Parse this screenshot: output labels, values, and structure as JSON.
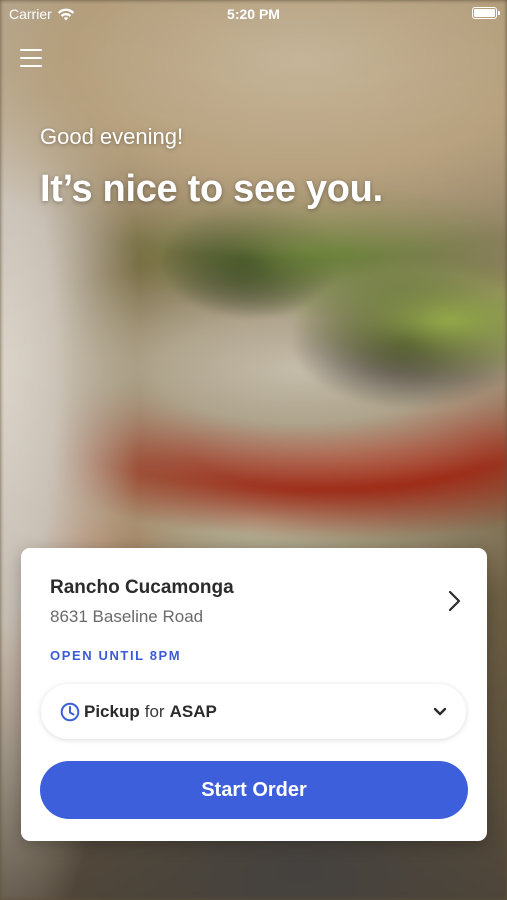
{
  "status_bar": {
    "carrier": "Carrier",
    "time": "5:20 PM",
    "icons": [
      "wifi-icon",
      "battery-icon"
    ]
  },
  "header": {
    "menu_icon": "hamburger-menu-icon"
  },
  "greeting": {
    "salutation": "Good evening!",
    "message": "It’s nice to see you."
  },
  "location_card": {
    "name": "Rancho Cucamonga",
    "address": "8631 Baseline Road",
    "hours_status": "OPEN UNTIL 8PM",
    "chevron_icon": "chevron-right-icon"
  },
  "order_mode": {
    "icon": "clock-icon",
    "mode": "Pickup",
    "connector": "for",
    "time": "ASAP",
    "dropdown_icon": "chevron-down-icon"
  },
  "actions": {
    "start_order_label": "Start Order"
  },
  "colors": {
    "accent": "#3d5fdb",
    "open_status": "#3b5bdb",
    "card_background": "#ffffff"
  }
}
